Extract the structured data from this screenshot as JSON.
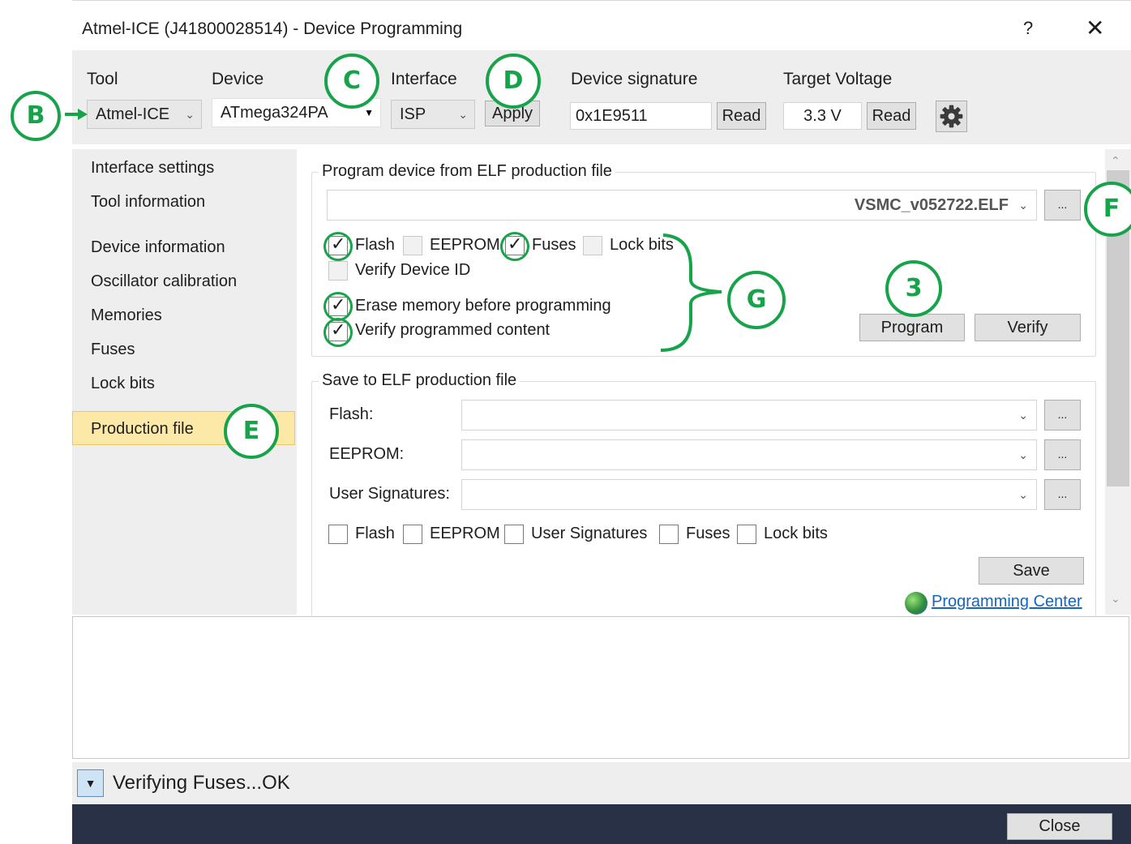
{
  "window": {
    "title": "Atmel-ICE (J41800028514) - Device Programming",
    "help_label": "?",
    "close_glyph": "✕"
  },
  "toolbar": {
    "tool_label": "Tool",
    "tool_value": "Atmel-ICE",
    "device_label": "Device",
    "device_value": "ATmega324PA",
    "interface_label": "Interface",
    "interface_value": "ISP",
    "apply_label": "Apply",
    "signature_label": "Device signature",
    "signature_value": "0x1E9511",
    "signature_read_label": "Read",
    "voltage_label": "Target Voltage",
    "voltage_value": "3.3 V",
    "voltage_read_label": "Read",
    "settings_icon": "gear-icon"
  },
  "sidebar": {
    "items": [
      {
        "label": "Interface settings"
      },
      {
        "label": "Tool information"
      },
      {
        "label": "Device information"
      },
      {
        "label": "Oscillator calibration"
      },
      {
        "label": "Memories"
      },
      {
        "label": "Fuses"
      },
      {
        "label": "Lock bits"
      },
      {
        "label": "Production file",
        "active": true
      }
    ]
  },
  "program_group": {
    "title": "Program device from ELF production file",
    "file_value": "VSMC_v052722.ELF",
    "browse_label": "...",
    "checks": {
      "flash": {
        "label": "Flash",
        "checked": true
      },
      "eeprom": {
        "label": "EEPROM",
        "checked": false
      },
      "fuses": {
        "label": "Fuses",
        "checked": true
      },
      "lockbits": {
        "label": "Lock bits",
        "checked": false
      },
      "verify_id": {
        "label": "Verify Device ID",
        "checked": false
      },
      "erase": {
        "label": "Erase memory before programming",
        "checked": true
      },
      "verify_content": {
        "label": "Verify programmed content",
        "checked": true
      }
    },
    "program_label": "Program",
    "verify_label": "Verify"
  },
  "save_group": {
    "title": "Save to ELF production file",
    "flash_label": "Flash:",
    "eeprom_label": "EEPROM:",
    "usersig_label": "User Signatures:",
    "browse_label": "...",
    "checks": {
      "flash": "Flash",
      "eeprom": "EEPROM",
      "usersig": "User Signatures",
      "fuses": "Fuses",
      "lockbits": "Lock bits"
    },
    "save_label": "Save",
    "programming_center_label": "Programming Center"
  },
  "status": {
    "message": "Verifying Fuses...OK"
  },
  "footer": {
    "close_label": "Close"
  },
  "annotations": {
    "B": "B",
    "C": "C",
    "D": "D",
    "E": "E",
    "F": "F",
    "G": "G",
    "step3": "3"
  },
  "colors": {
    "annotation": "#16a34a",
    "active_nav": "#fce9a7",
    "footer": "#283145",
    "link": "#1565c0"
  }
}
